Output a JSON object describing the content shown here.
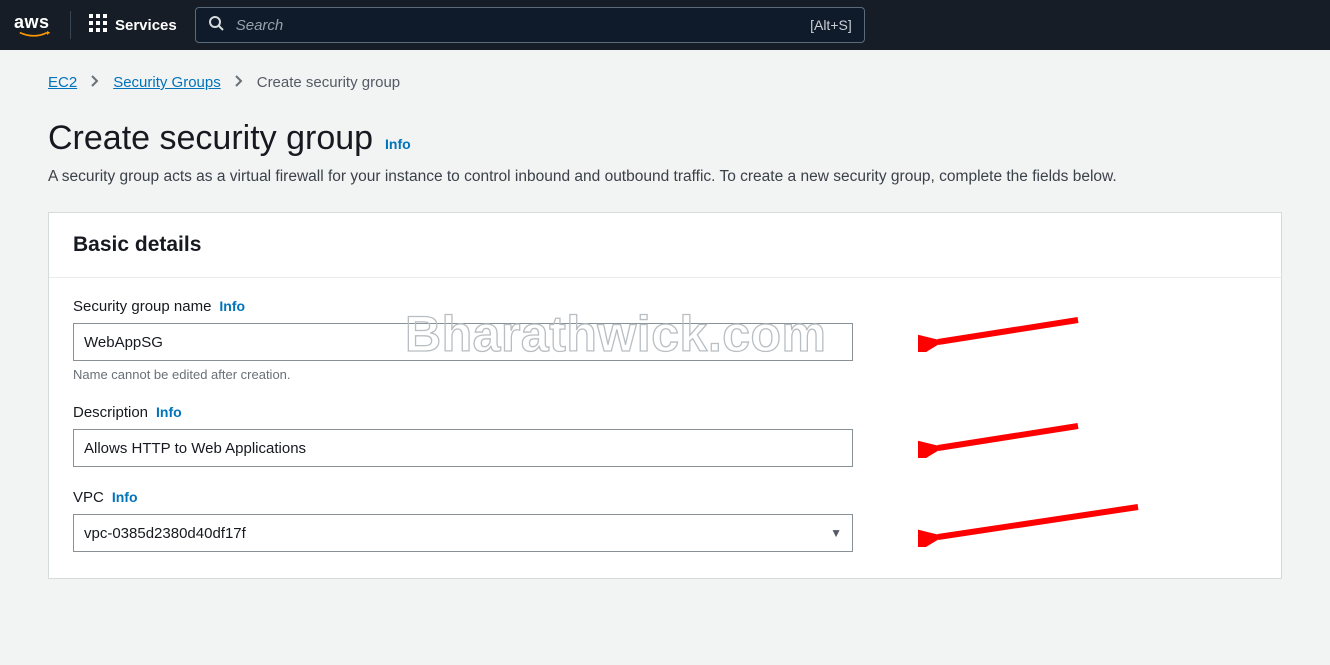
{
  "nav": {
    "services_label": "Services",
    "search_placeholder": "Search",
    "shortcut": "[Alt+S]"
  },
  "breadcrumb": {
    "items": [
      {
        "label": "EC2"
      },
      {
        "label": "Security Groups"
      }
    ],
    "current": "Create security group"
  },
  "page": {
    "title": "Create security group",
    "info_label": "Info",
    "subtitle": "A security group acts as a virtual firewall for your instance to control inbound and outbound traffic. To create a new security group, complete the fields below."
  },
  "card": {
    "title": "Basic details",
    "sg_name": {
      "label": "Security group name",
      "info": "Info",
      "value": "WebAppSG",
      "hint": "Name cannot be edited after creation."
    },
    "description": {
      "label": "Description",
      "info": "Info",
      "value": "Allows HTTP to Web Applications"
    },
    "vpc": {
      "label": "VPC",
      "info": "Info",
      "value": "vpc-0385d2380d40df17f"
    }
  },
  "watermark": "Bharathwick.com"
}
